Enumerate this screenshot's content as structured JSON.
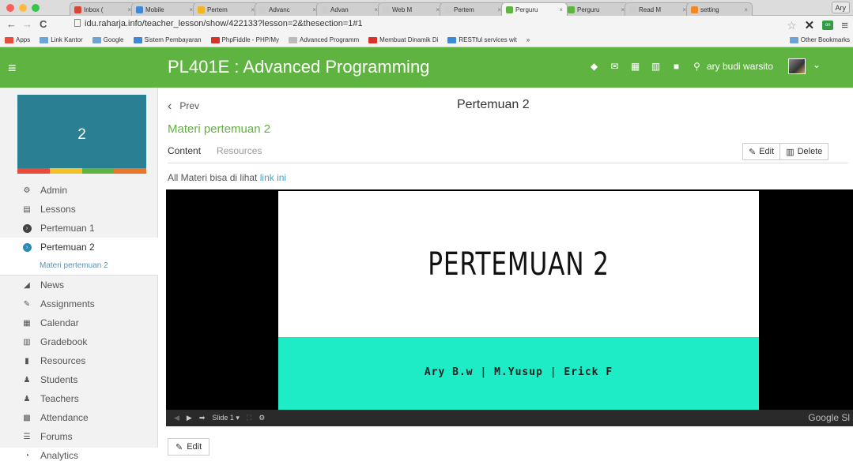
{
  "browser": {
    "tabs": [
      {
        "label": "Inbox (",
        "color": "#d44638",
        "active": false
      },
      {
        "label": "Mobile",
        "color": "#3f88d6",
        "active": false
      },
      {
        "label": "Pertem",
        "color": "#f3b622",
        "active": false
      },
      {
        "label": "Advanc",
        "color": "#cccccc",
        "active": false
      },
      {
        "label": "Advan",
        "color": "#cccccc",
        "active": false
      },
      {
        "label": "Web M",
        "color": "#cccccc",
        "active": false
      },
      {
        "label": "Pertem",
        "color": "#cccccc",
        "active": false
      },
      {
        "label": "Perguru",
        "color": "#5fb341",
        "active": true
      },
      {
        "label": "Perguru",
        "color": "#5fb341",
        "active": false
      },
      {
        "label": "Read M",
        "color": "#cccccc",
        "active": false
      },
      {
        "label": "setting",
        "color": "#f08a24",
        "active": false
      }
    ],
    "profile": "Ary",
    "url": "idu.raharja.info/teacher_lesson/show/422133?lesson=2&thesection=1#1",
    "bookmarks": [
      {
        "label": "Apps",
        "color": "#e94b3c"
      },
      {
        "label": "Link Kantor",
        "color": "#6fa3d6"
      },
      {
        "label": "Google",
        "color": "#6fa3d6"
      },
      {
        "label": "Sistem Pembayaran",
        "color": "#3f88d6"
      },
      {
        "label": "PhpFiddle - PHP/My",
        "color": "#d9322a"
      },
      {
        "label": "Advanced Programm",
        "color": "#bbbbbb"
      },
      {
        "label": "Membuat Dinamik Di",
        "color": "#d9322a"
      },
      {
        "label": "RESTful services wit",
        "color": "#3f88d6"
      },
      {
        "label": "»",
        "color": ""
      }
    ],
    "other_bookmarks": "Other Bookmarks"
  },
  "header": {
    "course_title": "PL401E : Advanced Programming",
    "user_name": "ary budi warsito"
  },
  "sidebar": {
    "lesson_number": "2",
    "card_color": "#2a7f92",
    "strip_colors": [
      "#e84a3c",
      "#f3c12a",
      "#5fb341",
      "#e8762c"
    ],
    "items": [
      {
        "label": "Admin",
        "icon": "gear-icon",
        "glyph": "⚙"
      },
      {
        "label": "Lessons",
        "icon": "lessons-icon",
        "glyph": "▤"
      },
      {
        "label": "Pertemuan 1",
        "icon": "chevron-right-circle-icon",
        "glyph": "›"
      },
      {
        "label": "Pertemuan 2",
        "icon": "chevron-down-circle-icon",
        "glyph": "›"
      },
      {
        "label": "Materi pertemuan 2",
        "icon": "",
        "glyph": ""
      },
      {
        "label": "News",
        "icon": "megaphone-icon",
        "glyph": "◢"
      },
      {
        "label": "Assignments",
        "icon": "assignments-icon",
        "glyph": "✎"
      },
      {
        "label": "Calendar",
        "icon": "calendar-icon",
        "glyph": "▦"
      },
      {
        "label": "Gradebook",
        "icon": "gradebook-icon",
        "glyph": "▥"
      },
      {
        "label": "Resources",
        "icon": "resources-icon",
        "glyph": "▮"
      },
      {
        "label": "Students",
        "icon": "students-icon",
        "glyph": "♟"
      },
      {
        "label": "Teachers",
        "icon": "teachers-icon",
        "glyph": "♟"
      },
      {
        "label": "Attendance",
        "icon": "attendance-icon",
        "glyph": "▩"
      },
      {
        "label": "Forums",
        "icon": "forums-icon",
        "glyph": "☰"
      },
      {
        "label": "Analytics",
        "icon": "analytics-icon",
        "glyph": "◔"
      }
    ]
  },
  "main": {
    "prev_label": "Prev",
    "page_title": "Pertemuan 2",
    "subtitle": "Materi pertemuan 2",
    "tab_content": "Content",
    "tab_resources": "Resources",
    "edit_label": "Edit",
    "delete_label": "Delete",
    "info_text": "All Materi bisa di lihat",
    "info_link": "link ini"
  },
  "slide": {
    "title": "PERTEMUAN 2",
    "authors": "Ary B.w | M.Yusup | Erick F",
    "band_color": "#1eecc7",
    "slide_indicator": "Slide 1",
    "brand": "Google Sl"
  },
  "bottom_edit_label": "Edit"
}
